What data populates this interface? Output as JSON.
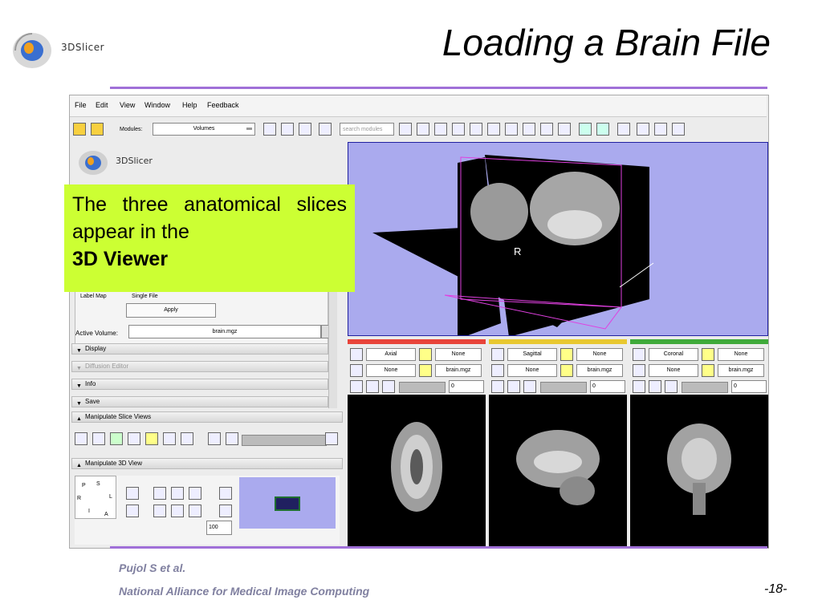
{
  "slide": {
    "title": "Loading a Brain File",
    "logo_text": "3DSlicer",
    "callout": {
      "text": "The three anatomical slices appear in the",
      "bold": "3D Viewer"
    },
    "footer_author": "Pujol S et al.",
    "footer_org": "National Alliance for Medical Image Computing",
    "page_number": "-18-"
  },
  "app": {
    "menu": [
      "File",
      "Edit",
      "View",
      "Window",
      "Help",
      "Feedback"
    ],
    "toolbar": {
      "modules_label": "Modules:",
      "module_selected": "Volumes",
      "search_placeholder": "search modules"
    },
    "logo_text": "3DSlicer",
    "left_panel": {
      "checkbox_label_map": "Label Map",
      "checkbox_single_file": "Single File",
      "apply_label": "Apply",
      "active_volume_label": "Active Volume:",
      "active_volume_value": "brain.mgz",
      "sections": [
        "Display",
        "Diffusion Editor",
        "Info",
        "Save"
      ],
      "manipulate_slice_views": "Manipulate Slice Views",
      "manipulate_3d_view": "Manipulate 3D View",
      "zoom_value": "100",
      "orientation_labels": [
        "P",
        "S",
        "R",
        "L",
        "I",
        "A"
      ]
    },
    "view3d": {
      "marker": "R"
    },
    "slice_viewers": [
      {
        "orientation": "Axial",
        "color": "#e8443a",
        "fg": "None",
        "bg": "None",
        "label": "brain.mgz",
        "offset": "0"
      },
      {
        "orientation": "Sagittal",
        "color": "#e8c830",
        "fg": "None",
        "bg": "None",
        "label": "brain.mgz",
        "offset": "0"
      },
      {
        "orientation": "Coronal",
        "color": "#3faa3a",
        "fg": "None",
        "bg": "None",
        "label": "brain.mgz",
        "offset": "0"
      }
    ]
  },
  "colors": {
    "accent_rule": "#a070d8",
    "callout_bg": "#ccff33",
    "view3d_bg": "#aaaaee"
  }
}
